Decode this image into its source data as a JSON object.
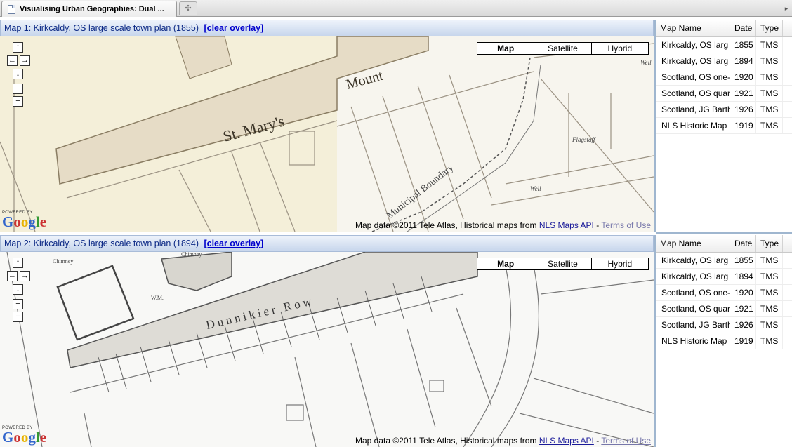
{
  "tab": {
    "title": "Visualising Urban Geographies: Dual ...",
    "icon": "document-icon"
  },
  "map_type_buttons": [
    "Map",
    "Satellite",
    "Hybrid"
  ],
  "controls": {
    "pan_up": "↑",
    "pan_left": "←",
    "pan_right": "→",
    "pan_down": "↓",
    "zoom_in": "+",
    "zoom_out": "−"
  },
  "attribution": {
    "prefix": "Map data ©2011 Tele Atlas, Historical maps from ",
    "nls": "NLS Maps API",
    "sep": " - ",
    "terms": "Terms of Use"
  },
  "google": {
    "powered": "POWERED BY",
    "logo": "Google"
  },
  "map1": {
    "title": "Map 1: Kirkcaldy, OS large scale town plan (1855)",
    "clear": "[clear overlay]",
    "labels": {
      "street": "St. Mary's",
      "mount": "Mount",
      "boundary": "Municipal Boundary",
      "flagstaff": "Flagstaff",
      "well1": "Well",
      "well2": "Well"
    }
  },
  "map2": {
    "title": "Map 2: Kirkcaldy, OS large scale town plan (1894)",
    "clear": "[clear overlay]",
    "labels": {
      "street": "Dunnikier Row",
      "chimney1": "Chimney",
      "chimney2": "Chimney",
      "wm": "W.M."
    }
  },
  "table": {
    "headers": [
      "Map Name",
      "Date",
      "Type"
    ],
    "rows": [
      [
        "Kirkcaldy, OS larg",
        "1855",
        "TMS"
      ],
      [
        "Kirkcaldy, OS larg",
        "1894",
        "TMS"
      ],
      [
        "Scotland, OS one-",
        "1920",
        "TMS"
      ],
      [
        "Scotland, OS quar",
        "1921",
        "TMS"
      ],
      [
        "Scotland, JG Barth",
        "1926",
        "TMS"
      ],
      [
        "NLS Historic Map",
        "1919",
        "TMS"
      ]
    ]
  }
}
